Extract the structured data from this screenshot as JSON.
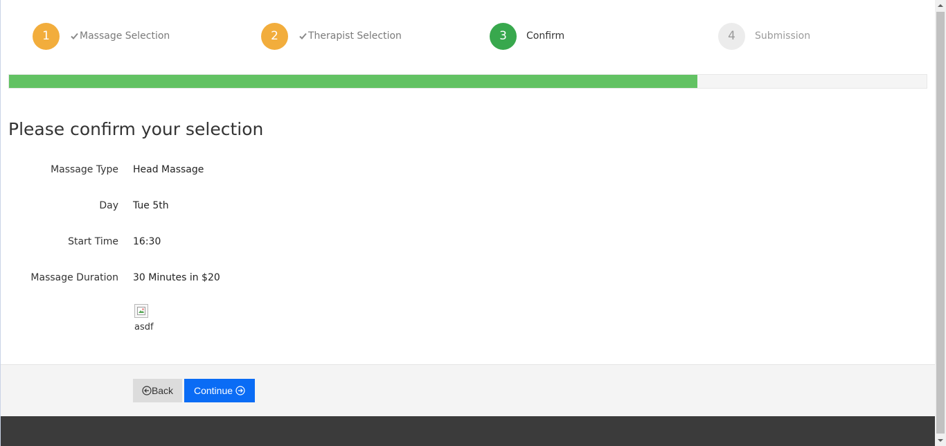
{
  "wizard": {
    "steps": [
      {
        "number": "1",
        "label": "Massage Selection",
        "state": "done"
      },
      {
        "number": "2",
        "label": "Therapist Selection",
        "state": "done"
      },
      {
        "number": "3",
        "label": "Confirm",
        "state": "active"
      },
      {
        "number": "4",
        "label": "Submission",
        "state": "pending"
      }
    ],
    "progress_percent": 75
  },
  "main": {
    "title": "Please confirm your selection",
    "rows": [
      {
        "label": "Massage Type",
        "value": "Head Massage"
      },
      {
        "label": "Day",
        "value": "Tue 5th"
      },
      {
        "label": "Start Time",
        "value": "16:30"
      },
      {
        "label": "Massage Duration",
        "value": "30 Minutes in $20"
      }
    ],
    "therapist": {
      "name": "asdf",
      "image_icon": "broken-image-icon"
    }
  },
  "actions": {
    "back_label": "Back",
    "continue_label": "Continue",
    "back_icon": "circle-arrow-left-icon",
    "continue_icon": "circle-arrow-right-icon"
  },
  "colors": {
    "step_done": "#f2ad3c",
    "step_active": "#38a84d",
    "step_pending": "#ececec",
    "progress_fill": "#62c263",
    "continue_button": "#0a6cf5",
    "footer": "#3b3b3b"
  }
}
